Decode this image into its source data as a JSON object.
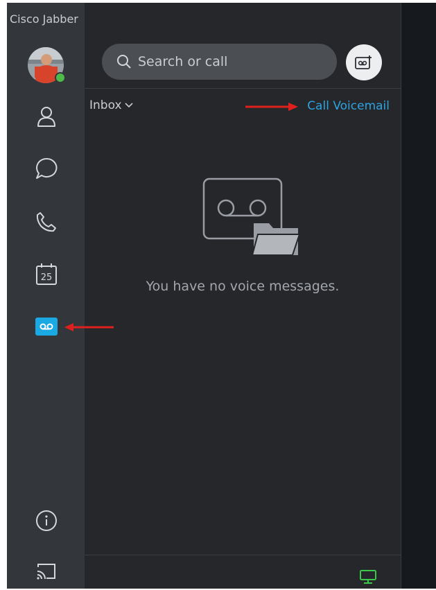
{
  "app": {
    "title": "Cisco Jabber"
  },
  "search": {
    "placeholder": "Search or call"
  },
  "voicemail": {
    "folder_label": "Inbox",
    "call_voicemail_label": "Call Voicemail",
    "empty_message": "You have no voice messages."
  },
  "calendar": {
    "day": "25"
  },
  "icons": {
    "contacts": "person-icon",
    "chats": "chat-bubble-icon",
    "calls": "phone-icon",
    "meetings": "calendar-icon",
    "voicemail": "voicemail-icon",
    "info": "info-icon",
    "cast": "cast-icon",
    "new_voicemail": "new-voicemail-icon",
    "device": "desk-phone-icon"
  },
  "colors": {
    "accent": "#1aa9e2",
    "link": "#2ea3e0",
    "presence_available": "#4cbb4a",
    "annotation_arrow": "#e0201c",
    "device_status": "#3cc94a"
  }
}
